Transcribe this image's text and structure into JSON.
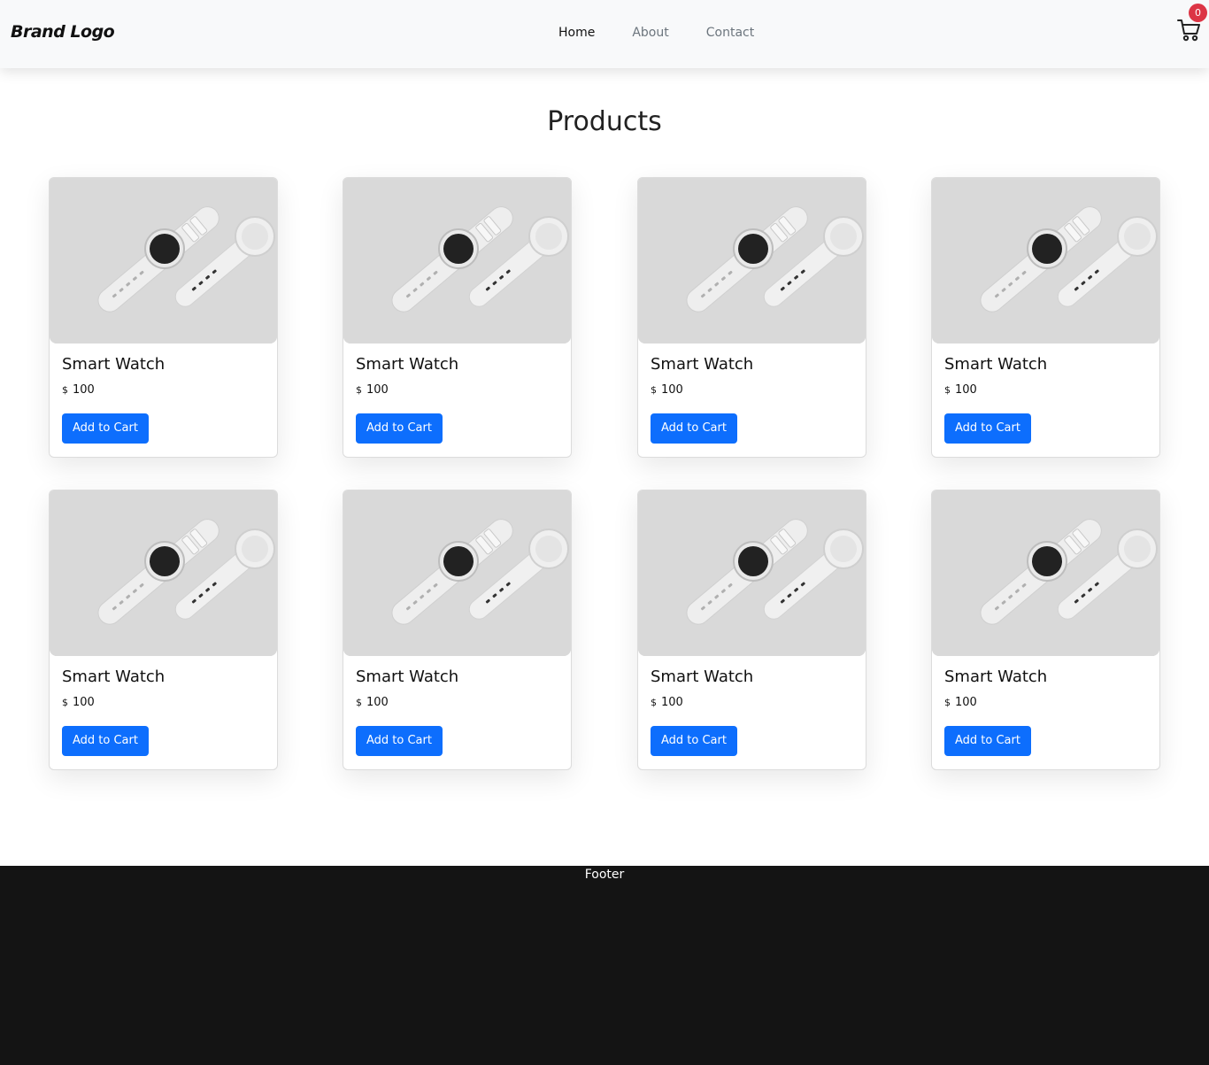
{
  "navbar": {
    "brand": "Brand Logo",
    "links": [
      "Home",
      "About",
      "Contact"
    ],
    "cart_count": "0",
    "colors": {
      "background": "#f8f9fa",
      "badge": "#dc3545"
    }
  },
  "main": {
    "title": "Products",
    "products": [
      {
        "name": "Smart Watch",
        "currency": "$",
        "price": "100",
        "button": "Add to Cart"
      },
      {
        "name": "Smart Watch",
        "currency": "$",
        "price": "100",
        "button": "Add to Cart"
      },
      {
        "name": "Smart Watch",
        "currency": "$",
        "price": "100",
        "button": "Add to Cart"
      },
      {
        "name": "Smart Watch",
        "currency": "$",
        "price": "100",
        "button": "Add to Cart"
      },
      {
        "name": "Smart Watch",
        "currency": "$",
        "price": "100",
        "button": "Add to Cart"
      },
      {
        "name": "Smart Watch",
        "currency": "$",
        "price": "100",
        "button": "Add to Cart"
      },
      {
        "name": "Smart Watch",
        "currency": "$",
        "price": "100",
        "button": "Add to Cart"
      },
      {
        "name": "Smart Watch",
        "currency": "$",
        "price": "100",
        "button": "Add to Cart"
      }
    ],
    "colors": {
      "button": "#0d6efd"
    }
  },
  "footer": {
    "text": "Footer",
    "background": "#141414"
  }
}
